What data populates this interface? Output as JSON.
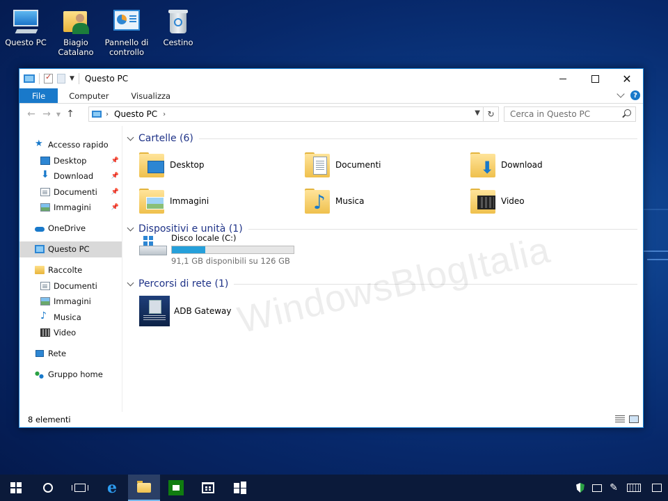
{
  "desktop": {
    "icons": [
      {
        "label": "Questo PC",
        "icon": "computer-icon"
      },
      {
        "label": "Biagio Catalano",
        "icon": "user-folder-icon"
      },
      {
        "label": "Pannello di controllo",
        "icon": "control-panel-icon"
      },
      {
        "label": "Cestino",
        "icon": "recycle-bin-icon"
      }
    ]
  },
  "window": {
    "title": "Questo PC",
    "ribbon": {
      "tabs": [
        "File",
        "Computer",
        "Visualizza"
      ]
    },
    "address": {
      "crumb": "Questo PC"
    },
    "search": {
      "placeholder": "Cerca in Questo PC"
    },
    "sidebar": {
      "items": [
        {
          "label": "Accesso rapido",
          "icon": "star-icon",
          "pinned": false
        },
        {
          "label": "Desktop",
          "icon": "desktop-icon",
          "pinned": true
        },
        {
          "label": "Download",
          "icon": "download-icon",
          "pinned": true
        },
        {
          "label": "Documenti",
          "icon": "documents-icon",
          "pinned": true
        },
        {
          "label": "Immagini",
          "icon": "pictures-icon",
          "pinned": true
        },
        {
          "label": "OneDrive",
          "icon": "onedrive-icon"
        },
        {
          "label": "Questo PC",
          "icon": "computer-icon",
          "selected": true
        },
        {
          "label": "Raccolte",
          "icon": "libraries-icon"
        },
        {
          "label": "Documenti",
          "icon": "documents-icon"
        },
        {
          "label": "Immagini",
          "icon": "pictures-icon"
        },
        {
          "label": "Musica",
          "icon": "music-icon"
        },
        {
          "label": "Video",
          "icon": "video-icon"
        },
        {
          "label": "Rete",
          "icon": "network-icon"
        },
        {
          "label": "Gruppo home",
          "icon": "homegroup-icon"
        }
      ]
    },
    "groups": {
      "folders": {
        "header": "Cartelle (6)",
        "items": [
          {
            "label": "Desktop",
            "icon": "desktop-folder-icon"
          },
          {
            "label": "Documenti",
            "icon": "documents-folder-icon"
          },
          {
            "label": "Download",
            "icon": "download-folder-icon"
          },
          {
            "label": "Immagini",
            "icon": "pictures-folder-icon"
          },
          {
            "label": "Musica",
            "icon": "music-folder-icon"
          },
          {
            "label": "Video",
            "icon": "video-folder-icon"
          }
        ]
      },
      "devices": {
        "header": "Dispositivi e unità (1)",
        "drive": {
          "name": "Disco locale (C:)",
          "free_text": "91,1 GB disponibili su 126 GB",
          "used_fraction": 0.277,
          "bar_color": "#26a0da"
        }
      },
      "network": {
        "header": "Percorsi di rete (1)",
        "items": [
          {
            "label": "ADB Gateway",
            "icon": "network-device-icon"
          }
        ]
      }
    },
    "watermark": "WindowsBlogItalia",
    "status": {
      "count": "8 elementi"
    }
  },
  "taskbar": {
    "buttons": [
      "start-icon",
      "cortana-icon",
      "task-view-icon",
      "edge-icon",
      "file-explorer-icon",
      "store-app-icon",
      "store-bag-icon",
      "windows-logo-icon"
    ],
    "active": "file-explorer-icon",
    "tray": [
      "defender-icon",
      "network-icon",
      "pen-icon",
      "keyboard-icon",
      "action-center-icon"
    ]
  },
  "colors": {
    "accent": "#1979ca",
    "group_header": "#1e3287",
    "selected_bg": "#d9d9d9"
  }
}
